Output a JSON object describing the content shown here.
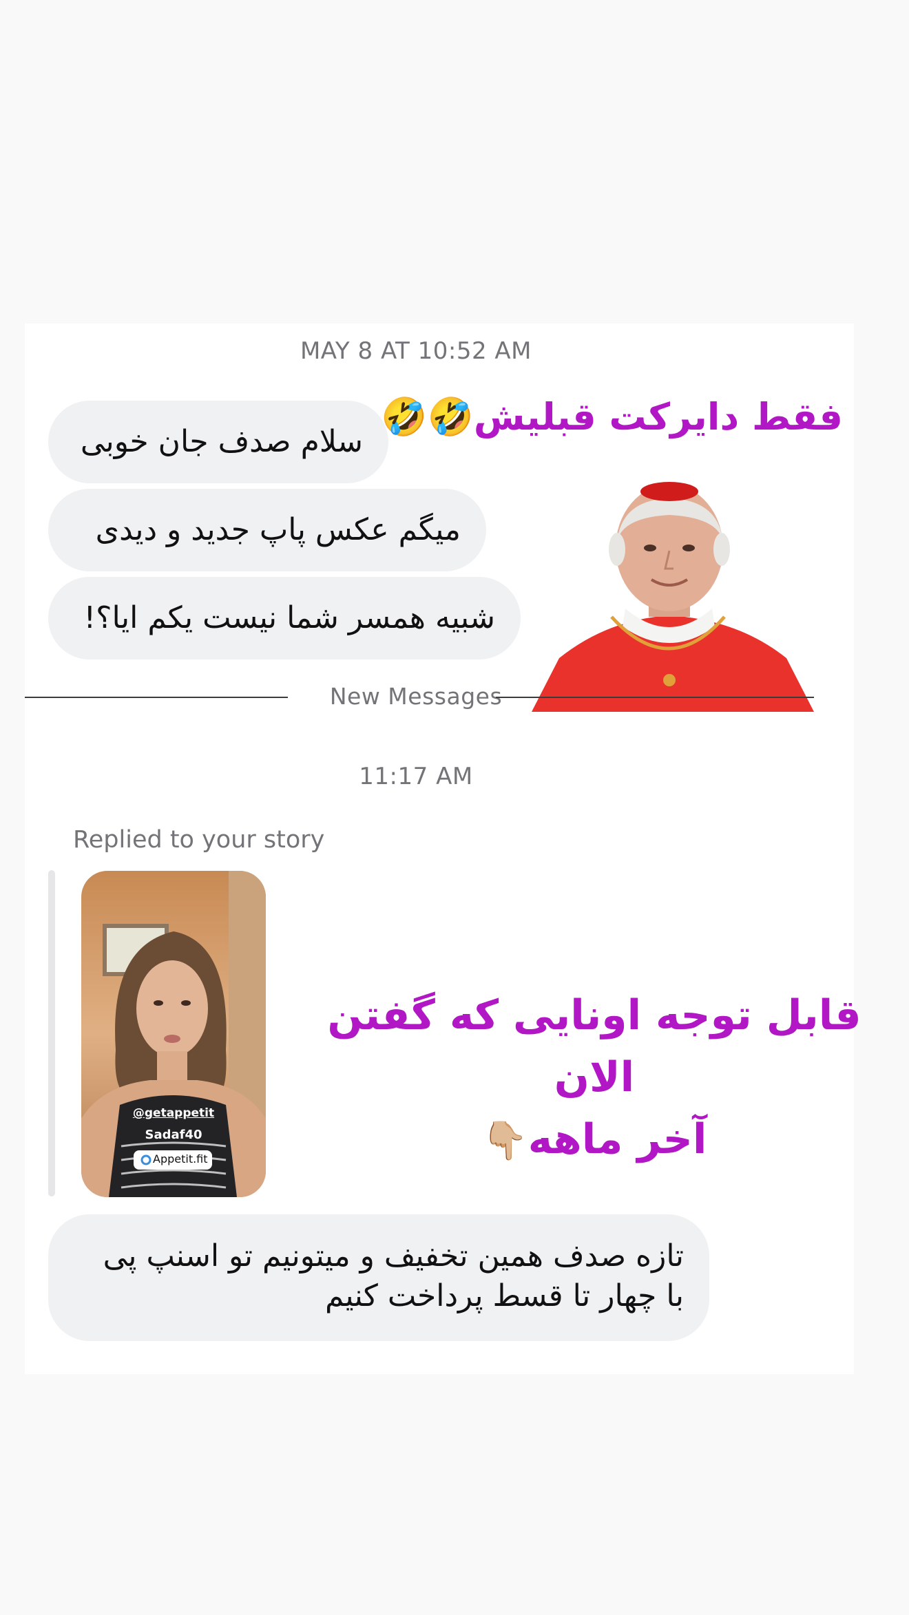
{
  "thread": {
    "timestamp_1": "MAY 8 AT 10:52 AM",
    "messages_1": [
      "سلام صدف جان خوبی",
      "میگم عکس پاپ جدید و دیدی",
      "شبیه همسر شما نیست یکم ایا؟!"
    ],
    "new_messages_label": "New Messages",
    "timestamp_2": "11:17 AM",
    "replied_label": "Replied to your story",
    "story": {
      "handle": "@getappetit",
      "code": "Sadaf40",
      "link_label": "Appetit.fit"
    },
    "message_2_line1": "تازه صدف همین تخفیف و میتونیم تو اسنپ پی",
    "message_2_line2": "با چهار تا قسط پرداخت کنیم"
  },
  "overlays": {
    "top_caption": "فقط دایرکت قبلیش",
    "top_emoji": "🤣🤣",
    "middle_caption_line1": "قابل توجه اونایی که گفتن الان",
    "middle_caption_line2": "آخر ماهه",
    "middle_emoji": "👇🏼"
  },
  "colors": {
    "page_bg": "#f9f9fa",
    "bubble_bg": "#f0f1f3",
    "overlay_text": "#b117c5",
    "timestamp_text": "#737378",
    "cardinal_red": "#e8322b"
  }
}
